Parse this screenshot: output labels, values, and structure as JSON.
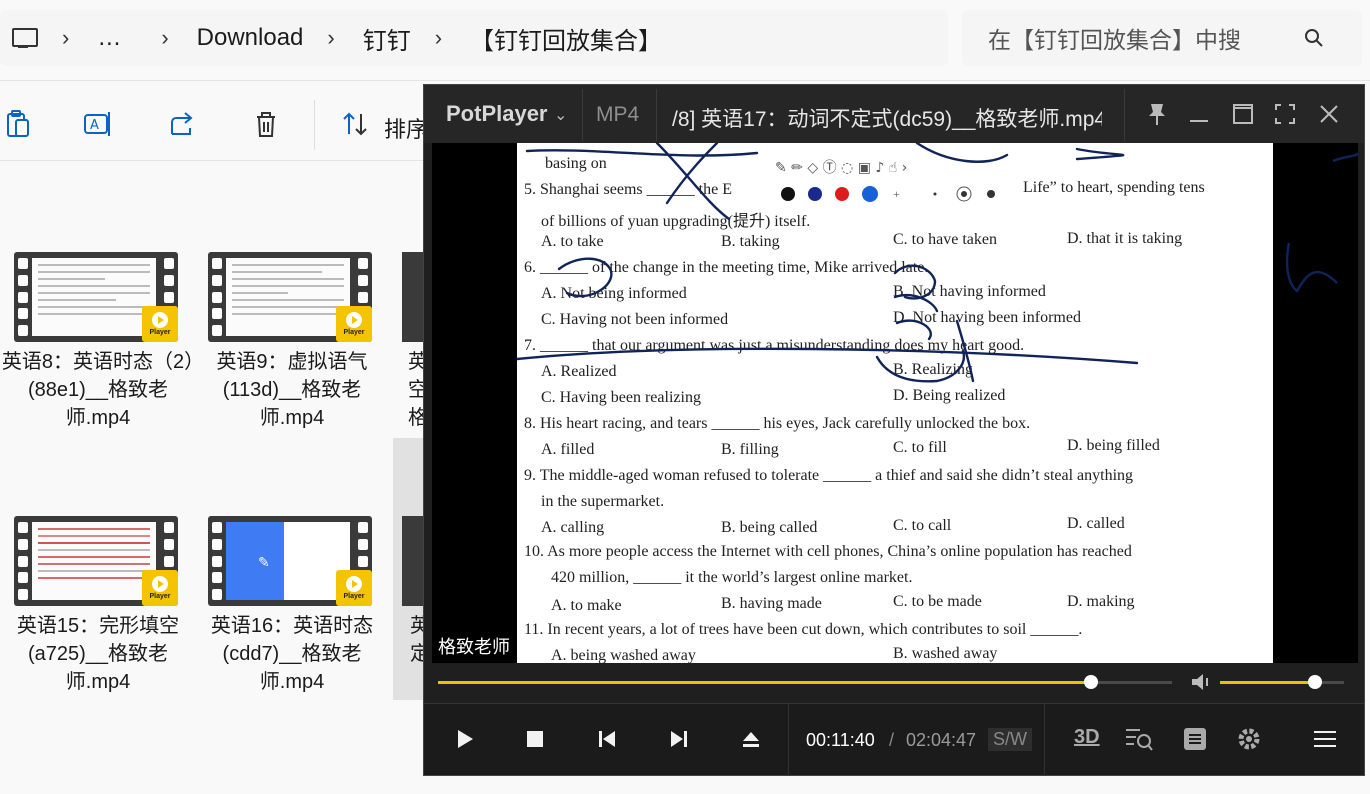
{
  "explorer": {
    "breadcrumb": [
      "…",
      "Download",
      "钉钉",
      "【钉钉回放集合】"
    ],
    "search_placeholder": "在【钉钉回放集合】中搜",
    "sort_label": "排序",
    "files": [
      {
        "name": "英语8：英语时态（2）(88e1)__格致老师.mp4"
      },
      {
        "name": "英语9：虚拟语气(113d)__格致老师.mp4"
      },
      {
        "name": "英语15：完形填空(a725)__格致老师.mp4"
      },
      {
        "name": "英语16：英语时态(cdd7)__格致老师.mp4"
      }
    ],
    "badge_label": "Player",
    "partial_labels": [
      "英",
      "空",
      "格",
      "英",
      "定"
    ]
  },
  "player": {
    "app_name": "PotPlayer",
    "format": "MP4",
    "title": "/8] 英语17：动词不定式(dc59)__格致老师.mp4",
    "watermark": "格致老师",
    "current_time": "00:11:40",
    "separator": "/",
    "total_time": "02:04:47",
    "sw_label": "S/W",
    "label_3d": "3D",
    "progress": 0.89,
    "volume": 0.77,
    "accent": "#f0c000"
  },
  "worksheet": {
    "lines": [
      {
        "id": "q4b",
        "text": "basing on"
      },
      {
        "id": "q5",
        "text": "5. Shanghai seems ______ the E",
        "tail": "Life” to heart, spending tens"
      },
      {
        "id": "q5b",
        "text": "of billions of yuan upgrading(提升) itself."
      },
      {
        "id": "q6",
        "text": "6. ______ of the change in the meeting time, Mike arrived late."
      },
      {
        "id": "q7",
        "text": "7. ______ that our argument was just a misunderstanding does my heart good."
      },
      {
        "id": "q8",
        "text": "8. His heart racing, and tears ______ his eyes, Jack carefully unlocked the box."
      },
      {
        "id": "q9",
        "text": "9. The middle-aged woman refused to tolerate ______ a thief and said she didn’t steal anything"
      },
      {
        "id": "q9b",
        "text": "in the supermarket."
      },
      {
        "id": "q10",
        "text": "10. As more people access the Internet with cell phones, China’s online population has reached"
      },
      {
        "id": "q10b",
        "text": "420 million, ______ it the world’s largest online market."
      },
      {
        "id": "q11",
        "text": "11. In recent years, a lot of trees have been cut down, which contributes to soil ______."
      }
    ],
    "options": {
      "q5": [
        "A. to take",
        "B. taking",
        "C. to have taken",
        "D. that it is taking"
      ],
      "q6": [
        "A. Not being informed",
        "B. Not having informed",
        "C. Having not been informed",
        "D. Not having been informed"
      ],
      "q7": [
        "A. Realized",
        "B. Realizing",
        "C. Having been realizing",
        "D. Being realized"
      ],
      "q8": [
        "A. filled",
        "B. filling",
        "C. to fill",
        "D. being filled"
      ],
      "q9": [
        "A. calling",
        "B. being called",
        "C. to call",
        "D. called"
      ],
      "q10": [
        "A. to make",
        "B. having made",
        "C. to be made",
        "D. making"
      ],
      "q11": [
        "A. being washed away",
        "B. washed away"
      ]
    }
  }
}
